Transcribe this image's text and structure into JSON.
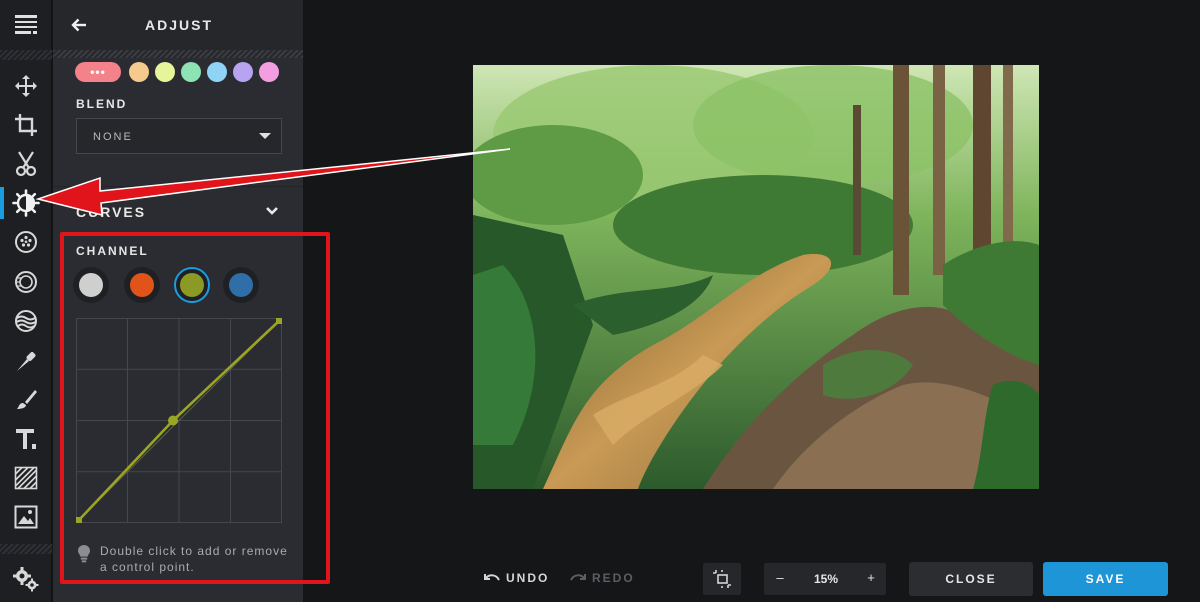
{
  "panel": {
    "title": "ADJUST",
    "blend_label": "BLEND",
    "blend_value": "NONE",
    "curves_title": "CURVES",
    "channel_label": "CHANNEL",
    "hint": "Double click to add or remove a control point.",
    "more_swatch_label": "•••"
  },
  "colors": {
    "accent": "#1a9de0",
    "highlight": "#e0141a",
    "swatch_more": "#f4828a",
    "swatch_orange": "#f6c98c",
    "swatch_yellow": "#e6f49a",
    "swatch_green": "#8ee3b4",
    "swatch_blue": "#8fd4f5",
    "swatch_purple": "#b7a3f0",
    "swatch_pink": "#f29ee0",
    "channel_rgb": "#cfcfcf",
    "channel_red": "#e0541a",
    "channel_green": "#8a9a25",
    "channel_blue": "#2f6ea6",
    "curve_line": "#9aa526"
  },
  "channels": [
    "rgb",
    "red",
    "green",
    "blue"
  ],
  "selected_channel": "green",
  "curve_points": [
    [
      0,
      0
    ],
    [
      0.47,
      0.5
    ],
    [
      1,
      1
    ]
  ],
  "icons": [
    "menu-icon",
    "move-icon",
    "crop-icon",
    "cut-icon",
    "adjust-icon",
    "filters-icon",
    "vignette-icon",
    "distort-icon",
    "retouch-icon",
    "brush-icon",
    "text-icon",
    "texture-icon",
    "image-icon",
    "settings-icon",
    "back-arrow-icon",
    "chevron-down-icon",
    "lightbulb-icon"
  ],
  "toolbar": {
    "undo_label": "UNDO",
    "redo_label": "REDO",
    "zoom_value": "15%",
    "zoom_minus": "–",
    "zoom_plus": "+",
    "close_label": "CLOSE",
    "save_label": "SAVE"
  }
}
